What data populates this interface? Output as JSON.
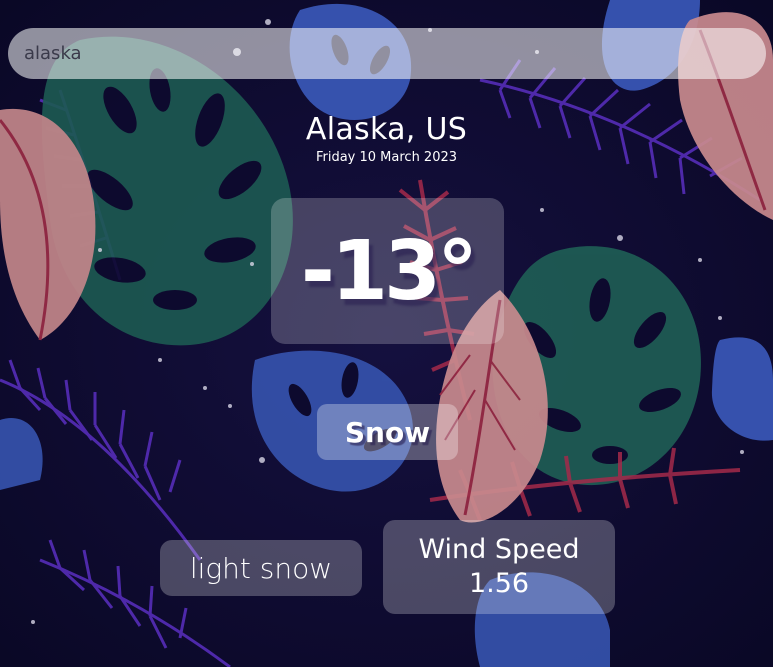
{
  "search": {
    "value": "alaska",
    "placeholder": ""
  },
  "weather": {
    "location": "Alaska, US",
    "date": "Friday 10 March 2023",
    "temperature": "-13°",
    "condition": "Snow",
    "description": "light snow",
    "wind_label": "Wind Speed",
    "wind_value": "1.56"
  },
  "colors": {
    "background": "#0d0a2e",
    "leaf_pink": "#c98a8e",
    "leaf_green": "#1f5f55",
    "leaf_blue": "#3a58b8",
    "leaf_purple": "#5b2ec4",
    "card": "rgba(255,255,255,0.25)",
    "text": "#ffffff"
  },
  "icons": {
    "background": "tropical-leaves-illustration"
  }
}
